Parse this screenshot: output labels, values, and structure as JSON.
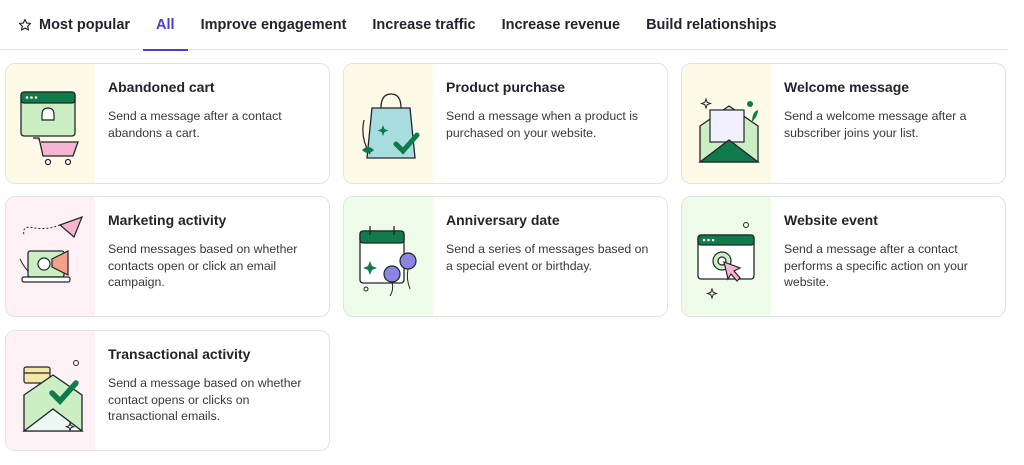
{
  "tabs": [
    {
      "label": "Most popular",
      "icon": "star-outline-icon",
      "active": false
    },
    {
      "label": "All",
      "active": true
    },
    {
      "label": "Improve engagement",
      "active": false
    },
    {
      "label": "Increase traffic",
      "active": false
    },
    {
      "label": "Increase revenue",
      "active": false
    },
    {
      "label": "Build relationships",
      "active": false
    }
  ],
  "colors": {
    "accent": "#4c3ec6",
    "dark_green": "#0f7a4a",
    "light_green": "#cbeec2",
    "pink": "#f5b6d2",
    "lavender": "#8b84e0",
    "aqua": "#a8dde0"
  },
  "cards": [
    {
      "title": "Abandoned cart",
      "description": "Send a message after a contact abandons a cart.",
      "illustration": "abandoned-cart-illustration"
    },
    {
      "title": "Product purchase",
      "description": "Send a message when a product is purchased on your website.",
      "illustration": "shopping-bag-illustration"
    },
    {
      "title": "Welcome message",
      "description": "Send a welcome message after a subscriber joins your list.",
      "illustration": "envelope-letter-illustration"
    },
    {
      "title": "Marketing activity",
      "description": "Send messages based on whether contacts open or click an email campaign.",
      "illustration": "megaphone-laptop-illustration"
    },
    {
      "title": "Anniversary date",
      "description": "Send a series of messages based on a special event or birthday.",
      "illustration": "calendar-balloons-illustration"
    },
    {
      "title": "Website event",
      "description": "Send a message after a contact performs a specific action on your website.",
      "illustration": "browser-click-illustration"
    },
    {
      "title": "Transactional activity",
      "description": "Send a message based on whether contact opens or clicks on transactional emails.",
      "illustration": "receipt-envelope-illustration"
    }
  ]
}
